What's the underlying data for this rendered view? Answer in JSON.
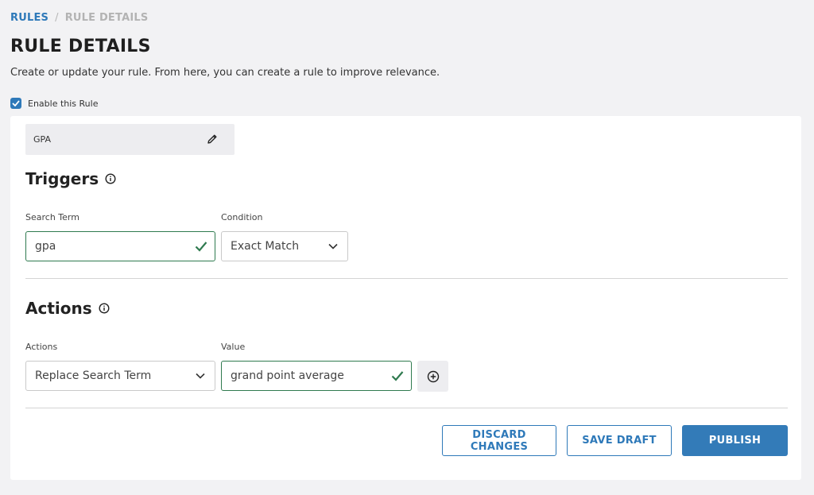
{
  "breadcrumb": {
    "root": "RULES",
    "separator": "/",
    "current": "RULE DETAILS"
  },
  "page": {
    "title": "RULE DETAILS",
    "description": "Create or update your rule. From here, you can create a rule to improve relevance."
  },
  "enable": {
    "label": "Enable this Rule",
    "checked": true
  },
  "rule_name": "GPA",
  "triggers": {
    "title": "Triggers",
    "search_term_label": "Search Term",
    "search_term_value": "gpa",
    "condition_label": "Condition",
    "condition_value": "Exact Match"
  },
  "actions": {
    "title": "Actions",
    "actions_label": "Actions",
    "actions_value": "Replace Search Term",
    "value_label": "Value",
    "value_value": "grand point average"
  },
  "buttons": {
    "discard": "DISCARD CHANGES",
    "save_draft": "SAVE DRAFT",
    "publish": "PUBLISH"
  },
  "colors": {
    "accent": "#2e79b9",
    "valid": "#2f7a4f"
  },
  "icons": [
    "checkbox-check-icon",
    "pencil-icon",
    "info-icon",
    "check-icon",
    "chevron-down-icon",
    "plus-circle-icon"
  ]
}
